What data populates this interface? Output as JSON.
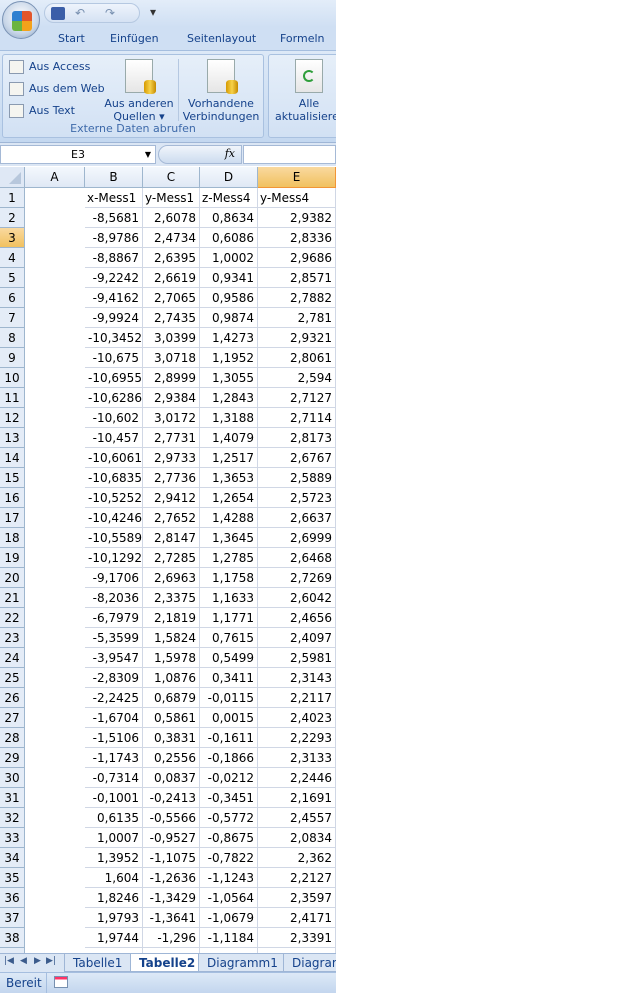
{
  "quick_access": {
    "save": "save-icon",
    "undo": "undo-icon",
    "redo": "redo-icon",
    "customize": "▾"
  },
  "tabs": [
    "Start",
    "Einfügen",
    "Seitenlayout",
    "Formeln"
  ],
  "ribbon": {
    "group_title": "Externe Daten abrufen",
    "small_buttons": [
      "Aus Access",
      "Aus dem Web",
      "Aus Text"
    ],
    "other_sources_l1": "Aus anderen",
    "other_sources_l2": "Quellen ▾",
    "existing_l1": "Vorhandene",
    "existing_l2": "Verbindungen",
    "refresh_l1": "Alle",
    "refresh_l2": "aktualisieren"
  },
  "formula_bar": {
    "name_box": "E3",
    "fx": "fx",
    "value": ""
  },
  "sheet": {
    "columns": [
      "A",
      "B",
      "C",
      "D",
      "E"
    ],
    "selected_column": "E",
    "selected_row": 3,
    "rows": [
      [
        "x-Mess1",
        "y-Mess1",
        "z-Mess4",
        "y-Mess4"
      ],
      [
        "-8,5681",
        "2,6078",
        "0,8634",
        "2,9382"
      ],
      [
        "-8,9786",
        "2,4734",
        "0,6086",
        "2,8336"
      ],
      [
        "-8,8867",
        "2,6395",
        "1,0002",
        "2,9686"
      ],
      [
        "-9,2242",
        "2,6619",
        "0,9341",
        "2,8571"
      ],
      [
        "-9,4162",
        "2,7065",
        "0,9586",
        "2,7882"
      ],
      [
        "-9,9924",
        "2,7435",
        "0,9874",
        "2,781"
      ],
      [
        "-10,3452",
        "3,0399",
        "1,4273",
        "2,9321"
      ],
      [
        "-10,675",
        "3,0718",
        "1,1952",
        "2,8061"
      ],
      [
        "-10,6955",
        "2,8999",
        "1,3055",
        "2,594"
      ],
      [
        "-10,6286",
        "2,9384",
        "1,2843",
        "2,7127"
      ],
      [
        "-10,602",
        "3,0172",
        "1,3188",
        "2,7114"
      ],
      [
        "-10,457",
        "2,7731",
        "1,4079",
        "2,8173"
      ],
      [
        "-10,6061",
        "2,9733",
        "1,2517",
        "2,6767"
      ],
      [
        "-10,6835",
        "2,7736",
        "1,3653",
        "2,5889"
      ],
      [
        "-10,5252",
        "2,9412",
        "1,2654",
        "2,5723"
      ],
      [
        "-10,4246",
        "2,7652",
        "1,4288",
        "2,6637"
      ],
      [
        "-10,5589",
        "2,8147",
        "1,3645",
        "2,6999"
      ],
      [
        "-10,1292",
        "2,7285",
        "1,2785",
        "2,6468"
      ],
      [
        "-9,1706",
        "2,6963",
        "1,1758",
        "2,7269"
      ],
      [
        "-8,2036",
        "2,3375",
        "1,1633",
        "2,6042"
      ],
      [
        "-6,7979",
        "2,1819",
        "1,1771",
        "2,4656"
      ],
      [
        "-5,3599",
        "1,5824",
        "0,7615",
        "2,4097"
      ],
      [
        "-3,9547",
        "1,5978",
        "0,5499",
        "2,5981"
      ],
      [
        "-2,8309",
        "1,0876",
        "0,3411",
        "2,3143"
      ],
      [
        "-2,2425",
        "0,6879",
        "-0,0115",
        "2,2117"
      ],
      [
        "-1,6704",
        "0,5861",
        "0,0015",
        "2,4023"
      ],
      [
        "-1,5106",
        "0,3831",
        "-0,1611",
        "2,2293"
      ],
      [
        "-1,1743",
        "0,2556",
        "-0,1866",
        "2,3133"
      ],
      [
        "-0,7314",
        "0,0837",
        "-0,0212",
        "2,2446"
      ],
      [
        "-0,1001",
        "-0,2413",
        "-0,3451",
        "2,1691"
      ],
      [
        "0,6135",
        "-0,5566",
        "-0,5772",
        "2,4557"
      ],
      [
        "1,0007",
        "-0,9527",
        "-0,8675",
        "2,0834"
      ],
      [
        "1,3952",
        "-1,1075",
        "-0,7822",
        "2,362"
      ],
      [
        "1,604",
        "-1,2636",
        "-1,1243",
        "2,2127"
      ],
      [
        "1,8246",
        "-1,3429",
        "-1,0564",
        "2,3597"
      ],
      [
        "1,9793",
        "-1,3641",
        "-1,0679",
        "2,4171"
      ],
      [
        "1,9744",
        "-1,296",
        "-1,1184",
        "2,3391"
      ]
    ]
  },
  "sheet_tabs": [
    "Tabelle1",
    "Tabelle2",
    "Diagramm1",
    "Diagramm"
  ],
  "active_sheet": "Tabelle2",
  "status": {
    "ready": "Bereit"
  }
}
